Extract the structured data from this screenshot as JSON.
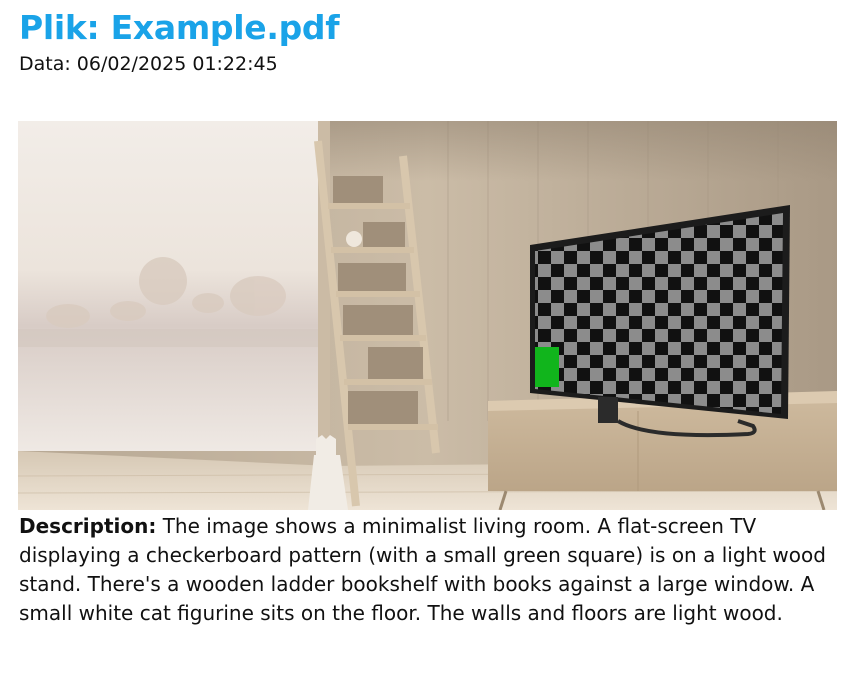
{
  "header": {
    "title": "Plik: Example.pdf",
    "date": "Data: 06/02/2025 01:22:45"
  },
  "description": {
    "label": "Description:",
    "text": " The image shows a minimalist living room.  A flat-screen TV displaying a checkerboard pattern (with a small green square) is on a light wood stand.  There's a wooden ladder bookshelf with books against a large window. A small white cat figurine sits on the floor. The walls and floors are light wood."
  },
  "colors": {
    "title": "#1aa3e8",
    "tv_square_dark": "#111111",
    "tv_square_light": "#8c8c8c",
    "tv_green_patch": "#11b51c"
  }
}
